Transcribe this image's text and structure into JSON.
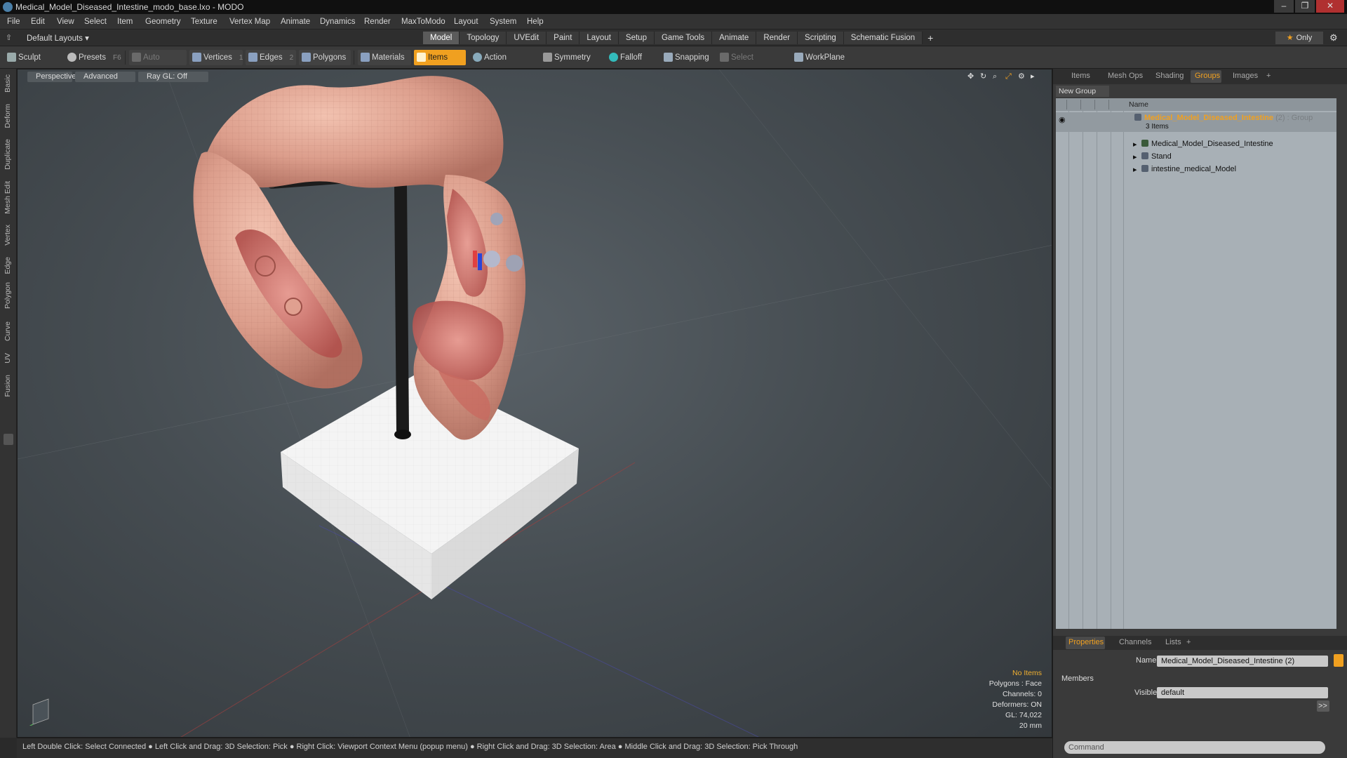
{
  "window": {
    "title": "Medical_Model_Diseased_Intestine_modo_base.lxo - MODO",
    "controls": [
      "–",
      "❐",
      "✕"
    ]
  },
  "menu": [
    "File",
    "Edit",
    "View",
    "Select",
    "Item",
    "Geometry",
    "Texture",
    "Vertex Map",
    "Animate",
    "Dynamics",
    "Render",
    "MaxToModo",
    "Layout",
    "System",
    "Help"
  ],
  "layout_bar": {
    "layouts": "Default Layouts ▾",
    "tabs": [
      "Model",
      "Topology",
      "UVEdit",
      "Paint",
      "Layout",
      "Setup",
      "Game Tools",
      "Animate",
      "Render",
      "Scripting",
      "Schematic Fusion"
    ],
    "active_tab": "Model",
    "add": "+",
    "only": "Only"
  },
  "toolbar": {
    "sculpt": "Sculpt",
    "presets": "Presets",
    "presets_key": "F6",
    "auto_select": "Auto Select",
    "vertices": "Vertices",
    "vertices_key": "1",
    "edges": "Edges",
    "edges_key": "2",
    "polygons": "Polygons",
    "materials": "Materials",
    "items": "Items",
    "action_center": "Action Center",
    "symmetry": "Symmetry",
    "falloff": "Falloff",
    "snapping": "Snapping",
    "select_through": "Select Through",
    "workplane": "WorkPlane"
  },
  "left_tabs": [
    "Basic",
    "Deform",
    "Duplicate",
    "Mesh Edit",
    "Vertex",
    "Edge",
    "Polygon",
    "Curve",
    "UV",
    "Fusion"
  ],
  "viewport": {
    "view": "Perspective",
    "shading": "Advanced",
    "raygl": "Ray GL: Off",
    "info": {
      "no_items": "No Items",
      "polygons": "Polygons : Face",
      "channels": "Channels: 0",
      "deformers": "Deformers: ON",
      "gl": "GL: 74,022",
      "scale": "20 mm"
    }
  },
  "status": "Left Double Click: Select Connected ● Left Click and Drag: 3D Selection: Pick ● Right Click: Viewport Context Menu (popup menu) ● Right Click and Drag: 3D Selection: Area ● Middle Click and Drag: 3D Selection: Pick Through",
  "right_panel": {
    "tabs": [
      "Items",
      "Mesh Ops",
      "Shading",
      "Groups",
      "Images",
      "+"
    ],
    "active_tab": "Groups",
    "new_group": "New Group",
    "column_name": "Name",
    "group": {
      "name": "Medical_Model_Diseased_Intestine",
      "count": "(2) : Group",
      "items_label": "3 Items"
    },
    "children": [
      "Medical_Model_Diseased_Intestine",
      "Stand",
      "intestine_medical_Model"
    ],
    "props_tabs": [
      "Properties",
      "Channels",
      "Lists",
      "+"
    ],
    "name_label": "Name",
    "name_value": "Medical_Model_Diseased_Intestine (2)",
    "members_label": "Members",
    "visible_label": "Visible",
    "visible_value": "default",
    "more": ">>",
    "command_placeholder": "Command"
  }
}
